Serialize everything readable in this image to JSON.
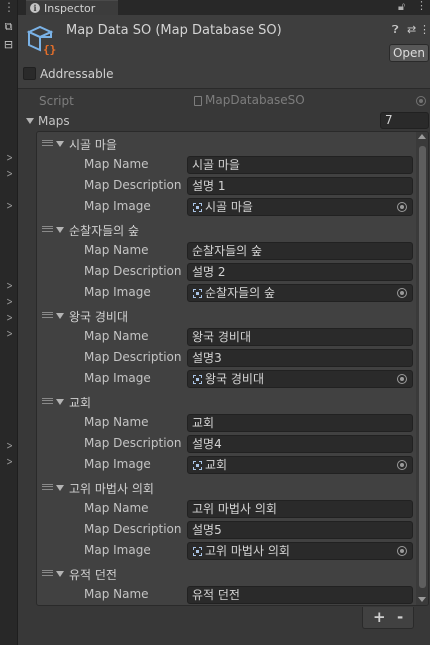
{
  "tab": {
    "label": "Inspector"
  },
  "header": {
    "title": "Map Data SO (Map Database SO)",
    "open_label": "Open",
    "addressable_label": "Addressable"
  },
  "script_row": {
    "label": "Script",
    "value": "MapDatabaseSO"
  },
  "maps": {
    "label": "Maps",
    "count": "7",
    "field_labels": {
      "name": "Map Name",
      "description": "Map Description",
      "image": "Map Image"
    },
    "elements": [
      {
        "title": "시골 마을",
        "name": "시골 마을",
        "description": "설명 1",
        "image": "시골 마을"
      },
      {
        "title": "순찰자들의 숲",
        "name": "순찰자들의 숲",
        "description": "설명 2",
        "image": "순찰자들의 숲"
      },
      {
        "title": "왕국 경비대",
        "name": "왕국 경비대",
        "description": "설명3",
        "image": "왕국 경비대"
      },
      {
        "title": "교회",
        "name": "교회",
        "description": "설명4",
        "image": "교회"
      },
      {
        "title": "고위 마법사 의회",
        "name": "고위 마법사 의회",
        "description": "설명5",
        "image": "고위 마법사 의회"
      },
      {
        "title": "유적 던전",
        "name": "유적 던전"
      }
    ],
    "add_label": "+",
    "remove_label": "-"
  },
  "colors": {
    "background": "#383838",
    "header": "#3e3e3e",
    "field": "#2a2a2a",
    "list": "#414141",
    "icon_blue": "#7ab2e6",
    "icon_orange": "#e8702a"
  },
  "icons": [
    "info-icon",
    "lock-icon",
    "kebab-menu-icon",
    "scriptable-object-icon",
    "help-icon",
    "preset-icon",
    "object-picker-icon",
    "drag-handle-icon",
    "foldout-arrow-icon"
  ]
}
